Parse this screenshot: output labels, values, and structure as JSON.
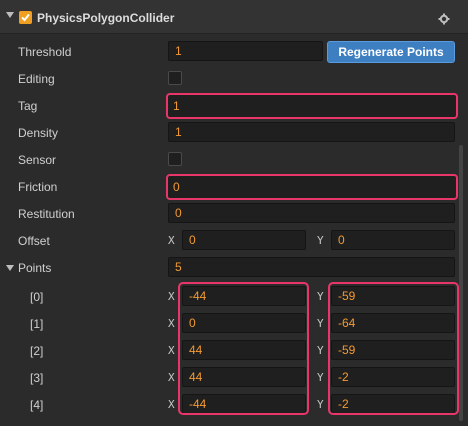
{
  "component": {
    "title": "PhysicsPolygonCollider",
    "enabled": true,
    "accent": "#f0a020",
    "highlight": "#e8366a"
  },
  "props": {
    "threshold_label": "Threshold",
    "threshold_value": "1",
    "regenerate_label": "Regenerate Points",
    "editing_label": "Editing",
    "tag_label": "Tag",
    "tag_value": "1",
    "density_label": "Density",
    "density_value": "1",
    "sensor_label": "Sensor",
    "friction_label": "Friction",
    "friction_value": "0",
    "restitution_label": "Restitution",
    "restitution_value": "0",
    "offset_label": "Offset",
    "offset_x": "0",
    "offset_y": "0",
    "points_label": "Points",
    "points_count": "5"
  },
  "axis": {
    "x": "X",
    "y": "Y"
  },
  "points": [
    {
      "index": "[0]",
      "x": "-44",
      "y": "-59"
    },
    {
      "index": "[1]",
      "x": "0",
      "y": "-64"
    },
    {
      "index": "[2]",
      "x": "44",
      "y": "-59"
    },
    {
      "index": "[3]",
      "x": "44",
      "y": "-2"
    },
    {
      "index": "[4]",
      "x": "-44",
      "y": "-2"
    }
  ]
}
